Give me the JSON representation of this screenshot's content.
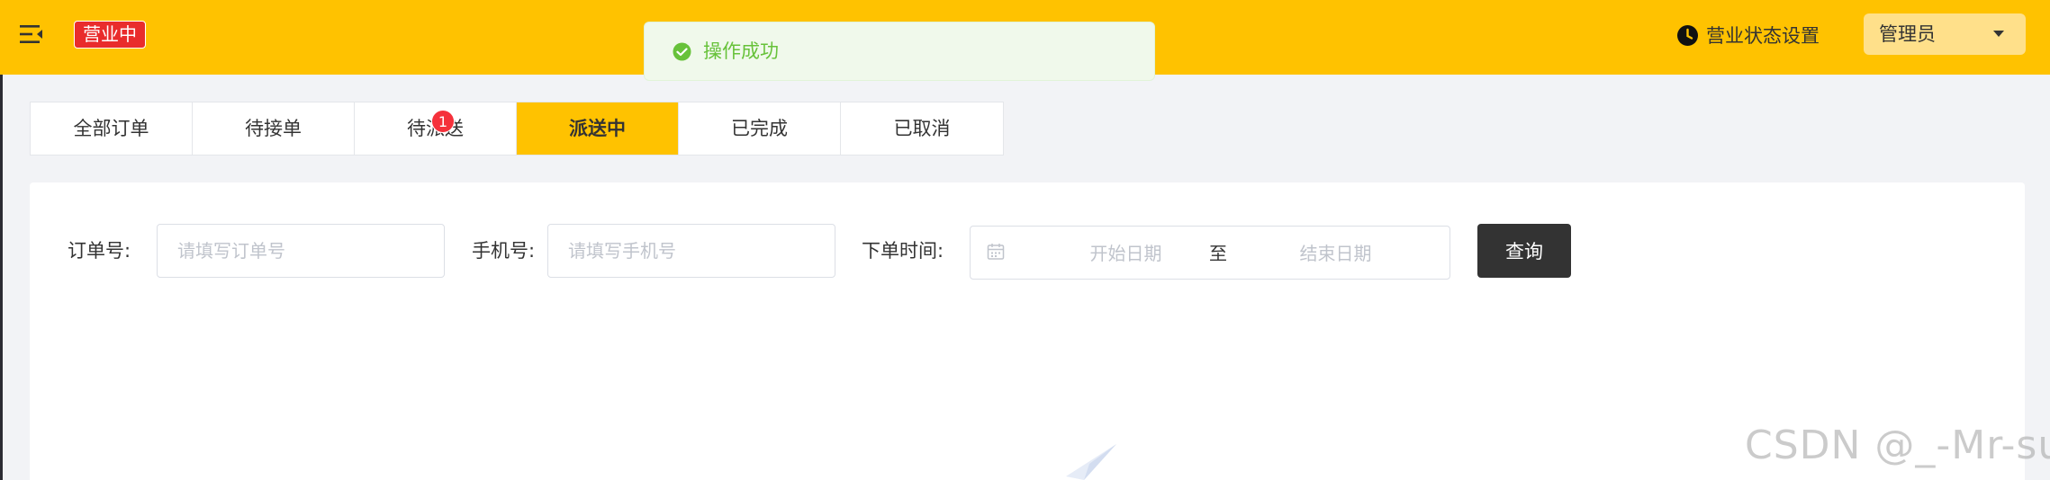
{
  "header": {
    "status_tag": "营业中",
    "settings_label": "营业状态设置",
    "user_name": "管理员",
    "brand_color": "#ffc200",
    "status_color": "#e92c2c"
  },
  "toast": {
    "message": "操作成功",
    "type": "success",
    "color": "#67c23a"
  },
  "tabs": [
    {
      "label": "全部订单"
    },
    {
      "label": "待接单"
    },
    {
      "label": "待派送",
      "badge": "1"
    },
    {
      "label": "派送中",
      "active": true
    },
    {
      "label": "已完成"
    },
    {
      "label": "已取消"
    }
  ],
  "search": {
    "order_label": "订单号:",
    "order_placeholder": "请填写订单号",
    "phone_label": "手机号:",
    "phone_placeholder": "请填写手机号",
    "time_label": "下单时间:",
    "date_start_placeholder": "开始日期",
    "date_separator": "至",
    "date_end_placeholder": "结束日期",
    "query_label": "查询"
  },
  "watermark": "CSDN @_-Mr-sun"
}
